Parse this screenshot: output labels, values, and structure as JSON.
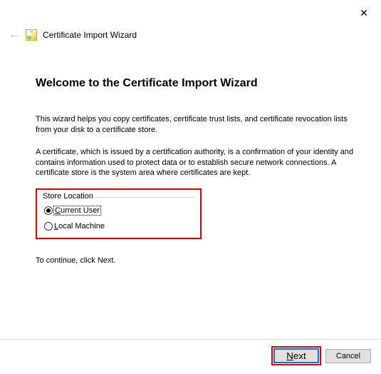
{
  "window": {
    "close_glyph": "✕",
    "back_glyph": "←",
    "title_small": "Certificate Import Wizard"
  },
  "main": {
    "heading": "Welcome to the Certificate Import Wizard",
    "paragraph_1": "This wizard helps you copy certificates, certificate trust lists, and certificate revocation lists from your disk to a certificate store.",
    "paragraph_2": "A certificate, which is issued by a certification authority, is a confirmation of your identity and contains information used to protect data or to establish secure network connections. A certificate store is the system area where certificates are kept.",
    "group_legend": "Store Location",
    "radio_options": {
      "opt1_prefix": "C",
      "opt1_rest": "urrent User",
      "opt2_prefix": "L",
      "opt2_rest": "ocal Machine"
    },
    "continue_text": "To continue, click Next."
  },
  "footer": {
    "next_prefix": "N",
    "next_rest": "ext",
    "cancel_label": "Cancel"
  }
}
